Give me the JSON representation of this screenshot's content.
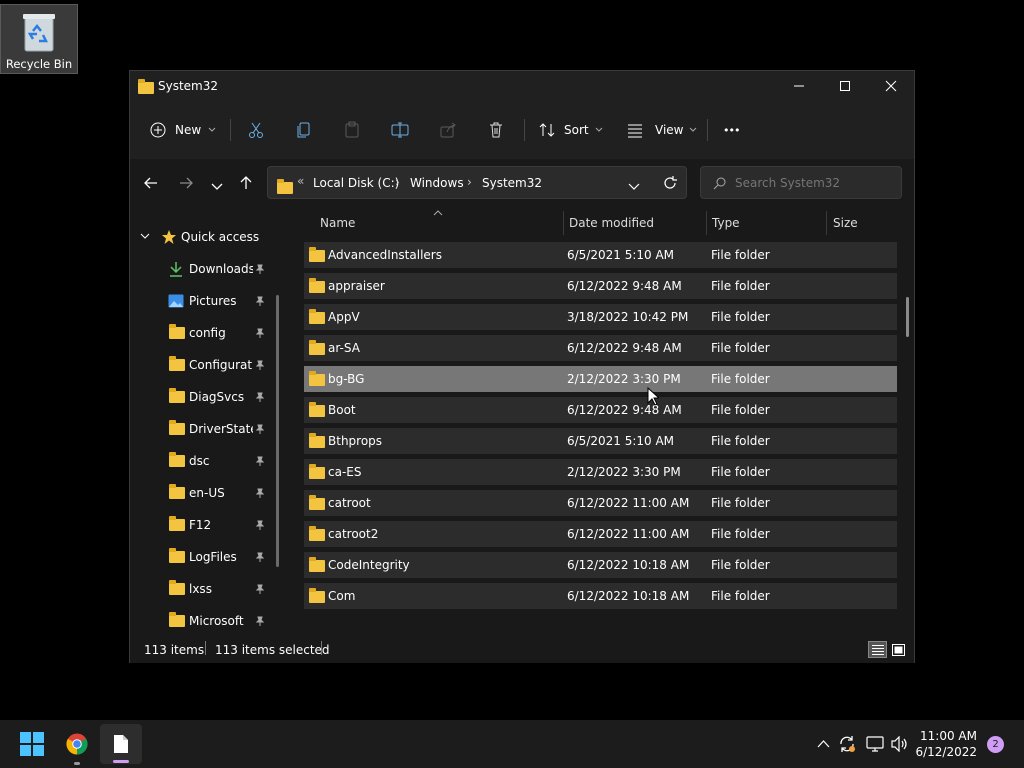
{
  "desktop": {
    "recycle_bin_label": "Recycle Bin"
  },
  "window": {
    "title": "System32",
    "toolbar": {
      "new_label": "New",
      "sort_label": "Sort",
      "view_label": "View",
      "more_label": "•••"
    },
    "address": {
      "overflow": "«",
      "crumbs": [
        "Local Disk (C:)",
        "Windows",
        "System32"
      ],
      "separator": "›"
    },
    "search": {
      "placeholder": "Search System32"
    },
    "nav": {
      "quick_access": "Quick access",
      "items": [
        {
          "label": "Downloads",
          "icon": "download-icon"
        },
        {
          "label": "Pictures",
          "icon": "pictures-icon"
        },
        {
          "label": "config",
          "icon": "folder-icon"
        },
        {
          "label": "Configuratic",
          "icon": "folder-icon"
        },
        {
          "label": "DiagSvcs",
          "icon": "folder-icon"
        },
        {
          "label": "DriverState",
          "icon": "folder-icon"
        },
        {
          "label": "dsc",
          "icon": "folder-icon"
        },
        {
          "label": "en-US",
          "icon": "folder-icon"
        },
        {
          "label": "F12",
          "icon": "folder-icon"
        },
        {
          "label": "LogFiles",
          "icon": "folder-icon"
        },
        {
          "label": "lxss",
          "icon": "folder-icon"
        },
        {
          "label": "Microsoft",
          "icon": "folder-icon"
        }
      ]
    },
    "columns": {
      "name": "Name",
      "date": "Date modified",
      "type": "Type",
      "size": "Size"
    },
    "files": [
      {
        "name": "AdvancedInstallers",
        "date": "6/5/2021 5:10 AM",
        "type": "File folder"
      },
      {
        "name": "appraiser",
        "date": "6/12/2022 9:48 AM",
        "type": "File folder"
      },
      {
        "name": "AppV",
        "date": "3/18/2022 10:42 PM",
        "type": "File folder"
      },
      {
        "name": "ar-SA",
        "date": "6/12/2022 9:48 AM",
        "type": "File folder"
      },
      {
        "name": "bg-BG",
        "date": "2/12/2022 3:30 PM",
        "type": "File folder"
      },
      {
        "name": "Boot",
        "date": "6/12/2022 9:48 AM",
        "type": "File folder"
      },
      {
        "name": "Bthprops",
        "date": "6/5/2021 5:10 AM",
        "type": "File folder"
      },
      {
        "name": "ca-ES",
        "date": "2/12/2022 3:30 PM",
        "type": "File folder"
      },
      {
        "name": "catroot",
        "date": "6/12/2022 11:00 AM",
        "type": "File folder"
      },
      {
        "name": "catroot2",
        "date": "6/12/2022 11:00 AM",
        "type": "File folder"
      },
      {
        "name": "CodeIntegrity",
        "date": "6/12/2022 10:18 AM",
        "type": "File folder"
      },
      {
        "name": "Com",
        "date": "6/12/2022 10:18 AM",
        "type": "File folder"
      }
    ],
    "selected_row": 4,
    "status": {
      "count": "113 items",
      "selected": "113 items selected"
    }
  },
  "taskbar": {
    "time": "11:00 AM",
    "date": "6/12/2022",
    "notification_count": "2"
  },
  "colors": {
    "folder": "#f3c43f",
    "accent": "#4cc2ff",
    "chrome_red": "#db4437"
  }
}
